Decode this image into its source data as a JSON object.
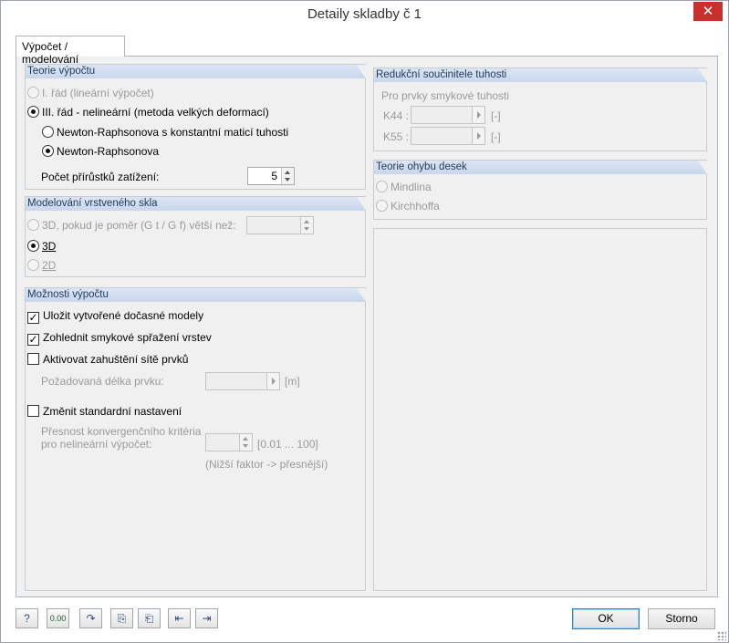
{
  "window": {
    "title": "Detaily skladby č 1",
    "close_glyph": "✕"
  },
  "tab": {
    "label": "Výpočet / modelování"
  },
  "teorie": {
    "header": "Teorie výpočtu",
    "opt1": "I. řád (lineární výpočet)",
    "opt2": "III. řád - nelineární (metoda velkých deformací)",
    "sub1": "Newton-Raphsonova s konstantní maticí tuhosti",
    "sub2": "Newton-Raphsonova",
    "steps_label": "Počet přírůstků zatížení:",
    "steps_value": "5"
  },
  "modelovani": {
    "header": "Modelování vrstveného skla",
    "opt3d_cond": "3D, pokud je poměr (G t / G f) větší než:",
    "opt3d_cond_value": "",
    "opt3d": "3D",
    "opt2d": "2D"
  },
  "moznosti": {
    "header": "Možnosti výpočtu",
    "save_models": "Uložit vytvořené dočasné modely",
    "shear_coupling": "Zohlednit smykové spřažení vrstev",
    "mesh_refine": "Aktivovat zahuštění sítě prvků",
    "elem_length_label": "Požadovaná délka prvku:",
    "elem_length_value": "",
    "elem_length_unit": "[m]",
    "change_defaults": "Změnit standardní nastavení",
    "precision_label_1": "Přesnost konvergenčního kritéria",
    "precision_label_2": "pro nelineární výpočet:",
    "precision_value": "",
    "precision_range": "[0.01 ... 100]",
    "precision_note": "(Nižší faktor -> přesnější)"
  },
  "redukcni": {
    "header": "Redukční součinitele tuhosti",
    "subtitle": "Pro prvky smykové tuhosti",
    "k44_label": "K44 :",
    "k44_value": "",
    "k44_unit": "[-]",
    "k55_label": "K55 :",
    "k55_value": "",
    "k55_unit": "[-]"
  },
  "ohyb": {
    "header": "Teorie ohybu desek",
    "opt1": "Mindlina",
    "opt2": "Kirchhoffa"
  },
  "footer": {
    "ok": "OK",
    "cancel": "Storno",
    "units_icon_text": "0.00",
    "icons": [
      "help-icon",
      "units-icon",
      "redo-icon",
      "copy-icon",
      "paste-icon",
      "import-icon",
      "export-icon"
    ]
  },
  "colors": {
    "close_red": "#c7302b",
    "group_header_text": "#1e395b"
  }
}
